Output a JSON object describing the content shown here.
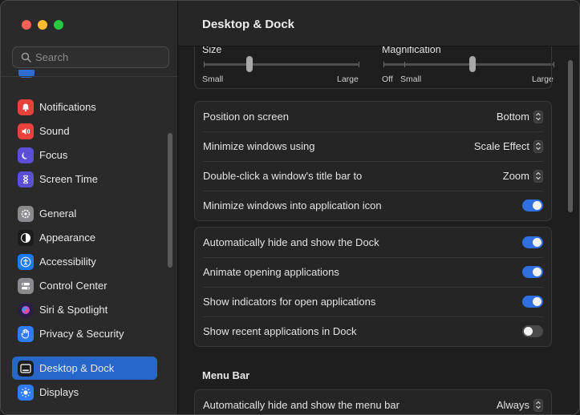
{
  "window": {
    "title": "Desktop & Dock"
  },
  "search": {
    "placeholder": "Search"
  },
  "sidebar": {
    "items": [
      {
        "label": "Notifications",
        "icon": "bell-icon",
        "color": "#e8403b"
      },
      {
        "label": "Sound",
        "icon": "speaker-icon",
        "color": "#e8403b"
      },
      {
        "label": "Focus",
        "icon": "moon-icon",
        "color": "#5a4fd6"
      },
      {
        "label": "Screen Time",
        "icon": "hourglass-icon",
        "color": "#5a4fd6"
      },
      {
        "label": "General",
        "icon": "gear-icon",
        "color": "#8a8a8e"
      },
      {
        "label": "Appearance",
        "icon": "appearance-icon",
        "color": "#1c1c1c"
      },
      {
        "label": "Accessibility",
        "icon": "accessibility-icon",
        "color": "#1e7cf2"
      },
      {
        "label": "Control Center",
        "icon": "control-center-icon",
        "color": "#8a8a8e"
      },
      {
        "label": "Siri & Spotlight",
        "icon": "siri-icon",
        "color": "#3a2a6a"
      },
      {
        "label": "Privacy & Security",
        "icon": "hand-icon",
        "color": "#2f7cf6"
      },
      {
        "label": "Desktop & Dock",
        "icon": "dock-icon",
        "color": "#1c1c1c",
        "selected": true
      },
      {
        "label": "Displays",
        "icon": "sun-icon",
        "color": "#2f7cf6"
      }
    ]
  },
  "sliders": {
    "size": {
      "label": "Size",
      "min_label": "Small",
      "max_label": "Large",
      "value": 0.31
    },
    "magnification": {
      "label": "Magnification",
      "off_label": "Off",
      "min_label": "Small",
      "max_label": "Large",
      "value": 0.57
    }
  },
  "group1": [
    {
      "label": "Position on screen",
      "type": "popup",
      "value": "Bottom"
    },
    {
      "label": "Minimize windows using",
      "type": "popup",
      "value": "Scale Effect"
    },
    {
      "label": "Double-click a window's title bar to",
      "type": "popup",
      "value": "Zoom"
    },
    {
      "label": "Minimize windows into application icon",
      "type": "toggle",
      "on": true
    }
  ],
  "group2": [
    {
      "label": "Automatically hide and show the Dock",
      "type": "toggle",
      "on": true
    },
    {
      "label": "Animate opening applications",
      "type": "toggle",
      "on": true
    },
    {
      "label": "Show indicators for open applications",
      "type": "toggle",
      "on": true
    },
    {
      "label": "Show recent applications in Dock",
      "type": "toggle",
      "on": false
    }
  ],
  "menu_bar": {
    "title": "Menu Bar",
    "rows": [
      {
        "label": "Automatically hide and show the menu bar",
        "type": "popup",
        "value": "Always"
      }
    ]
  },
  "colors": {
    "accent": "#2f6fdf",
    "selection": "#2767c9"
  }
}
